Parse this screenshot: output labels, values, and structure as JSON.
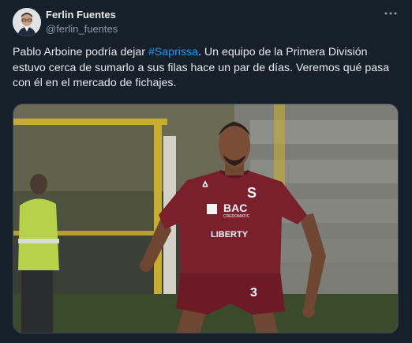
{
  "author": {
    "display_name": "Ferlin Fuentes",
    "handle": "@ferlin_fuentes"
  },
  "more_icon": "more-horizontal-icon",
  "text": {
    "before": "Pablo Arboine podría dejar ",
    "hashtag": "#Saprissa",
    "after": ". Un equipo de la Primera División estuvo cerca de sumarlo a sus filas hace un par de días. Veremos qué pasa con él en el mercado de fichajes."
  },
  "photo": {
    "sponsor_main": "BAC",
    "sponsor_sub": "CREDOMATIC",
    "sponsor_chest": "LIBERTY",
    "crest_letter": "S",
    "shorts_number": "3"
  },
  "colors": {
    "background": "#15202b",
    "text": "#e7e9ea",
    "secondary_text": "#8b98a5",
    "hashtag": "#1d9bf0",
    "jersey": "#7a1f2c"
  }
}
